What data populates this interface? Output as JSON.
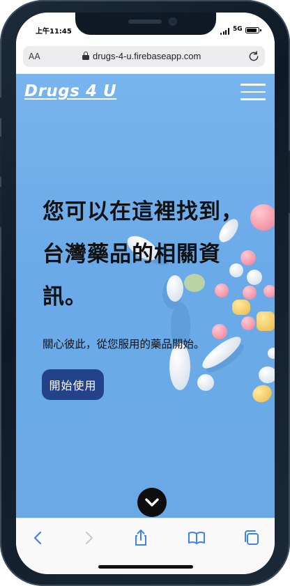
{
  "status_bar": {
    "time": "上午11:45",
    "network": "5G"
  },
  "browser": {
    "text_size_label": "AA",
    "url": "drugs-4-u.firebaseapp.com"
  },
  "page": {
    "brand": "Drugs 4 U",
    "headline_lines": [
      "您可以在這裡找到，",
      "台灣藥品的相關資",
      "訊。"
    ],
    "subtitle": "關心彼此，從您服用的藥品開始。",
    "start_button_label": "開始使用"
  },
  "icons": {
    "menu": "hamburger-menu-icon",
    "scroll": "chevron-down-icon",
    "lock": "lock-icon",
    "reload": "reload-icon",
    "back": "chevron-left-icon",
    "forward": "chevron-right-icon",
    "share": "share-icon",
    "bookmarks": "book-icon",
    "tabs": "tabs-icon"
  },
  "colors": {
    "accent_button": "#22428a",
    "hero_background": "#6faeeb",
    "toolbar_icon": "#3b82f6"
  }
}
